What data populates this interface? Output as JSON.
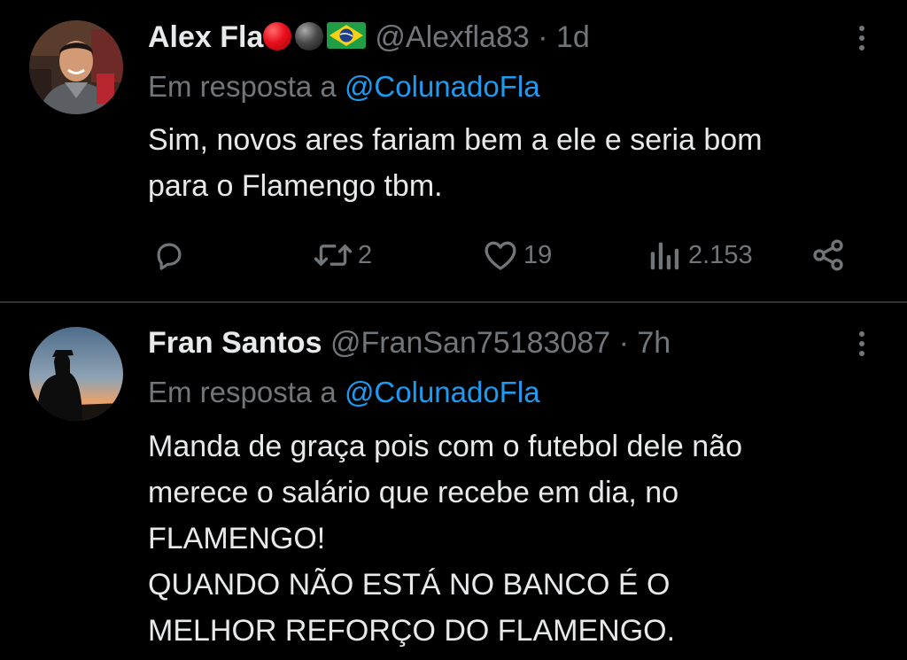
{
  "colors": {
    "background": "#000000",
    "primary_text": "#e7e9ea",
    "secondary_text": "#71767b",
    "link": "#1d9bf0",
    "divider": "#2f3336"
  },
  "tweets": [
    {
      "display_name": "Alex Fla",
      "name_emojis": [
        "red-ball",
        "black-ball",
        "brazil-flag"
      ],
      "handle": "@Alexfla83",
      "separator": "·",
      "time": "1d",
      "reply_prefix": "Em resposta a",
      "reply_to": "@ColunadoFla",
      "text_lines": [
        "Sim, novos ares fariam bem a ele e seria bom",
        "para o Flamengo tbm."
      ],
      "actions": {
        "reply_icon": "reply-icon",
        "retweet_icon": "retweet-icon",
        "retweets": "2",
        "like_icon": "heart-icon",
        "likes": "19",
        "views_icon": "views-icon",
        "views": "2.153",
        "share_icon": "share-icon"
      }
    },
    {
      "display_name": "Fran Santos",
      "handle": "@FranSan75183087",
      "separator": "·",
      "time": "7h",
      "reply_prefix": "Em resposta a",
      "reply_to": "@ColunadoFla",
      "text_lines": [
        "Manda de graça pois com o futebol dele não",
        "merece o salário que recebe em dia, no",
        "FLAMENGO!",
        "QUANDO NÃO ESTÁ NO BANCO É O",
        "MELHOR REFORÇO DO FLAMENGO."
      ]
    }
  ]
}
